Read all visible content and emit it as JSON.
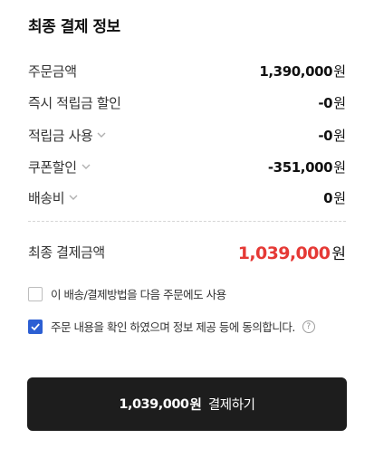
{
  "section_title": "최종 결제 정보",
  "currency_unit": "원",
  "rows": [
    {
      "label": "주문금액",
      "amount": "1,390,000",
      "has_chevron": false
    },
    {
      "label": "즉시 적립금 할인",
      "amount": "-0",
      "has_chevron": false
    },
    {
      "label": "적립금 사용",
      "amount": "-0",
      "has_chevron": true
    },
    {
      "label": "쿠폰할인",
      "amount": "-351,000",
      "has_chevron": true
    },
    {
      "label": "배송비",
      "amount": "0",
      "has_chevron": true
    }
  ],
  "total": {
    "label": "최종 결제금액",
    "amount": "1,039,000",
    "color": "#e53935"
  },
  "options": [
    {
      "label": "이 배송/결제방법을 다음 주문에도 사용",
      "checked": false
    },
    {
      "label": "주문 내용을 확인 하였으며 정보 제공 등에 동의합니다.",
      "checked": true,
      "help_icon": "question-mark-icon",
      "help_glyph": "?"
    }
  ],
  "pay_button": {
    "amount": "1,039,000",
    "unit": "원",
    "label": "결제하기"
  },
  "colors": {
    "accent_red": "#e53935",
    "checkbox_blue": "#2c5fd3",
    "button_bg": "#1d1d1d"
  }
}
